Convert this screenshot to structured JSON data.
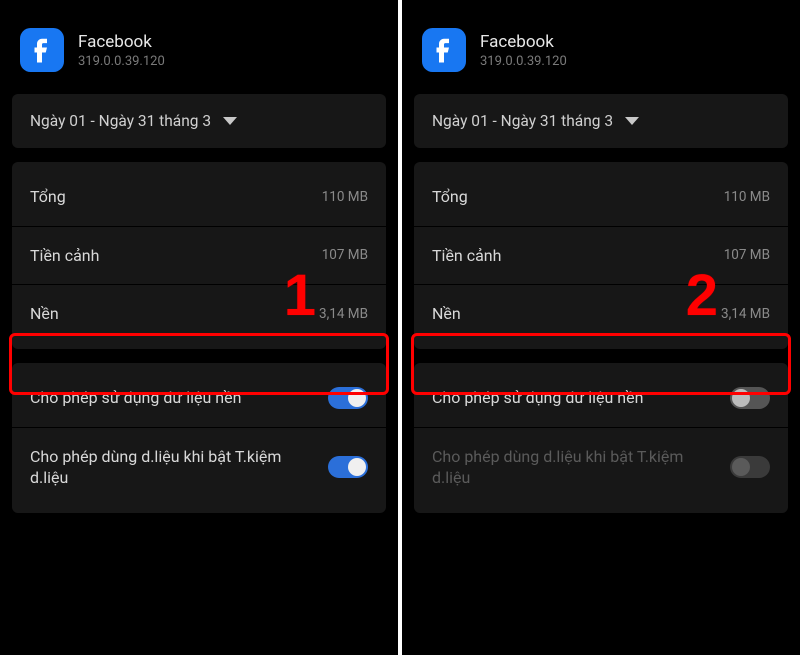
{
  "app": {
    "name": "Facebook",
    "version": "319.0.0.39.120"
  },
  "dateRange": "Ngày 01 - Ngày 31 tháng 3",
  "stats": {
    "totalLabel": "Tổng",
    "totalValue": "110 MB",
    "foregroundLabel": "Tiền cảnh",
    "foregroundValue": "107 MB",
    "backgroundLabel": "Nền",
    "backgroundValue": "3,14 MB"
  },
  "toggles": {
    "allowBg": "Cho phép sử dụng dữ liệu nền",
    "allowSaver": "Cho phép dùng d.liệu khi bật T.kiệm d.liệu"
  },
  "steps": {
    "one": "1",
    "two": "2"
  }
}
